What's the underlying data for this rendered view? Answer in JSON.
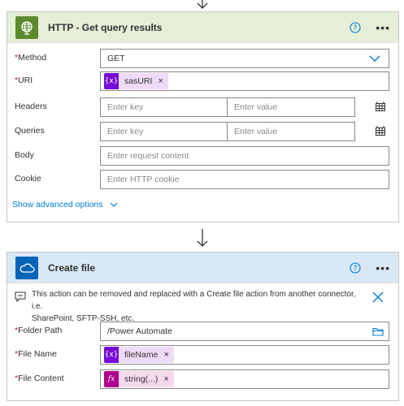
{
  "http_card": {
    "title": "HTTP - Get query results",
    "accent": "#5c8b2f",
    "header_bg": "#e5efd8",
    "icon": "globe-icon",
    "fields": {
      "method": {
        "label": "Method",
        "required": "*",
        "value": "GET"
      },
      "uri": {
        "label": "URI",
        "required": "*",
        "token": "sasURI"
      },
      "headers": {
        "label": "Headers",
        "key_placeholder": "Enter key",
        "value_placeholder": "Enter value"
      },
      "queries": {
        "label": "Queries",
        "key_placeholder": "Enter key",
        "value_placeholder": "Enter value"
      },
      "body": {
        "label": "Body",
        "placeholder": "Enter request content"
      },
      "cookie": {
        "label": "Cookie",
        "placeholder": "Enter HTTP cookie"
      }
    },
    "show_advanced": "Show advanced options"
  },
  "create_file_card": {
    "title": "Create file",
    "accent": "#0364b8",
    "header_bg": "#d8e8f7",
    "icon": "onedrive-cloud-icon",
    "info_text_line1": "This action can be removed and replaced with a Create file action from another connector, i.e.",
    "info_text_line2": "SharePoint, SFTP-SSH, etc.",
    "fields": {
      "folder_path": {
        "label": "Folder Path",
        "required": "*",
        "value": "/Power Automate"
      },
      "file_name": {
        "label": "File Name",
        "required": "*",
        "token": "fileName"
      },
      "file_content": {
        "label": "File Content",
        "required": "*",
        "token": "string(...)"
      }
    }
  },
  "token_colors": {
    "variable": "#770bd6",
    "variable_bg": "#efdbf7",
    "expression": "#ad008c",
    "expression_bg": "#f7d9ef"
  },
  "icons": [
    "help-icon",
    "more-icon",
    "chevron-down-icon",
    "close-icon",
    "table-icon",
    "folder-icon",
    "comment-icon",
    "arrow-down-icon"
  ]
}
